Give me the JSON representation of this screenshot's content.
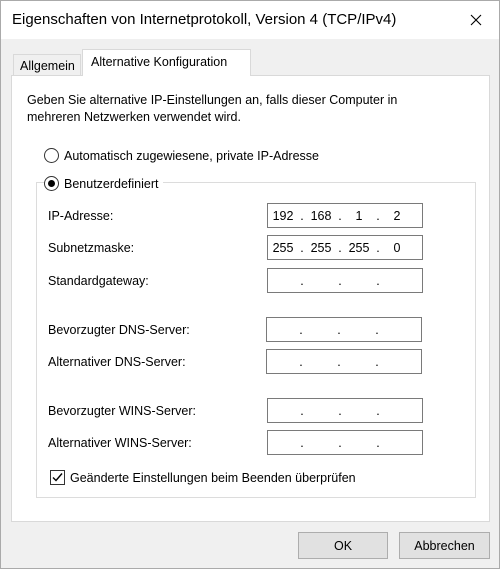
{
  "window": {
    "title": "Eigenschaften von Internetprotokoll, Version 4 (TCP/IPv4)"
  },
  "tabs": [
    {
      "label": "Allgemein",
      "active": false
    },
    {
      "label": "Alternative Konfiguration",
      "active": true
    }
  ],
  "panel": {
    "description": "Geben Sie alternative IP-Einstellungen an, falls dieser Computer in mehreren Netzwerken verwendet wird.",
    "radio_auto": {
      "label": "Automatisch zugewiesene, private IP-Adresse",
      "selected": false
    },
    "radio_custom": {
      "label": "Benutzerdefiniert",
      "selected": true
    },
    "fields": [
      {
        "label": "IP-Adresse:",
        "octets": [
          "192",
          "168",
          "1",
          "2"
        ]
      },
      {
        "label": "Subnetzmaske:",
        "octets": [
          "255",
          "255",
          "255",
          "0"
        ]
      },
      {
        "label": "Standardgateway:",
        "octets": [
          "",
          "",
          "",
          ""
        ]
      },
      {
        "label": "Bevorzugter DNS-Server:",
        "octets": [
          "",
          "",
          "",
          ""
        ]
      },
      {
        "label": "Alternativer DNS-Server:",
        "octets": [
          "",
          "",
          "",
          ""
        ]
      },
      {
        "label": "Bevorzugter WINS-Server:",
        "octets": [
          "",
          "",
          "",
          ""
        ]
      },
      {
        "label": "Alternativer WINS-Server:",
        "octets": [
          "",
          "",
          "",
          ""
        ]
      }
    ],
    "validate_checkbox": {
      "label": "Geänderte Einstellungen beim Beenden überprüfen",
      "checked": true
    }
  },
  "buttons": {
    "ok": "OK",
    "cancel": "Abbrechen"
  },
  "icons": {
    "close": "close-icon",
    "check": "check-icon"
  },
  "colors": {
    "panel_bg": "#ffffff",
    "window_bg": "#f0f0f0",
    "button_bg": "#e1e1e1",
    "border": "#7a7a7a"
  }
}
